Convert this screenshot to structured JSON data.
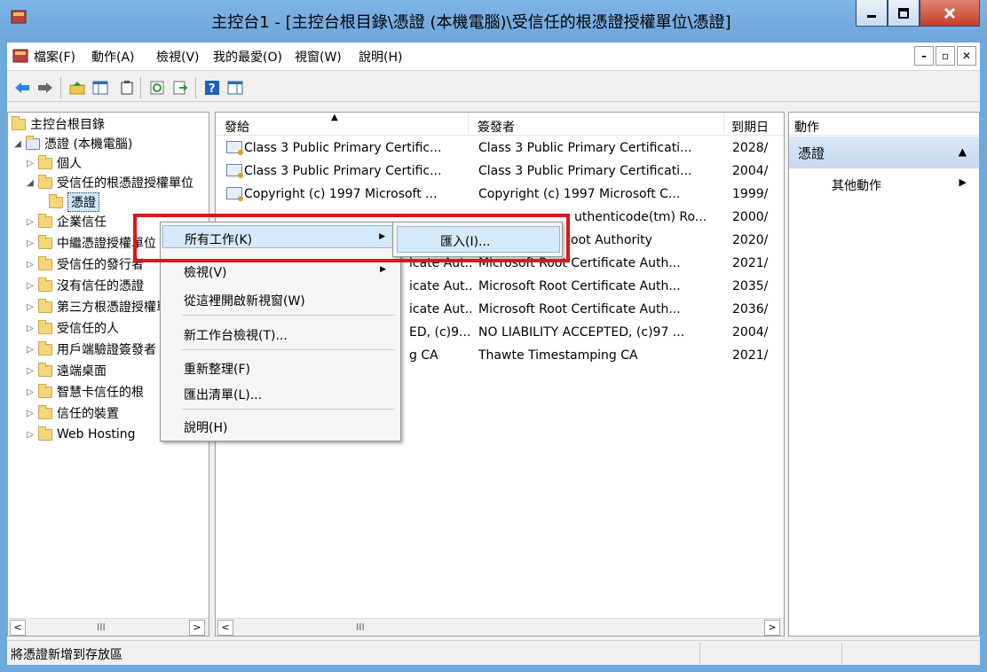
{
  "window": {
    "title": "主控台1 - [主控台根目錄\\憑證 (本機電腦)\\受信任的根憑證授權單位\\憑證]"
  },
  "menubar": {
    "items": [
      "檔案(F)",
      "動作(A)",
      "檢視(V)",
      "我的最愛(O)",
      "視窗(W)",
      "說明(H)"
    ]
  },
  "toolbar": {
    "icons": [
      "back-icon",
      "forward-icon",
      "up-folder-icon",
      "show-hide-tree-icon",
      "properties-icon",
      "refresh-icon",
      "export-list-icon",
      "help-icon",
      "show-hide-action-pane-icon"
    ]
  },
  "tree": {
    "root": "主控台根目錄",
    "items": [
      {
        "label": "憑證 (本機電腦)",
        "expanded": true
      },
      {
        "label": "個人",
        "expanded": false
      },
      {
        "label": "受信任的根憑證授權單位",
        "expanded": true
      },
      {
        "label": "憑證"
      },
      {
        "label": "企業信任",
        "expanded": false
      },
      {
        "label": "中繼憑證授權單位",
        "expanded": false
      },
      {
        "label": "受信任的發行者",
        "expanded": false
      },
      {
        "label": "沒有信任的憑證",
        "expanded": false
      },
      {
        "label": "第三方根憑證授權單位",
        "expanded": false
      },
      {
        "label": "受信任的人",
        "expanded": false
      },
      {
        "label": "用戶端驗證簽發者",
        "expanded": false
      },
      {
        "label": "遠端桌面",
        "expanded": false
      },
      {
        "label": "智慧卡信任的根",
        "expanded": false
      },
      {
        "label": "信任的裝置",
        "expanded": false
      },
      {
        "label": "Web Hosting",
        "expanded": false
      }
    ]
  },
  "list": {
    "columns": [
      "發給",
      "簽發者",
      "到期日"
    ],
    "rows": [
      {
        "issued_to": "Class 3 Public Primary Certific...",
        "issued_by": "Class 3 Public Primary Certificati...",
        "expires": "2028/"
      },
      {
        "issued_to": "Class 3 Public Primary Certific...",
        "issued_by": "Class 3 Public Primary Certificati...",
        "expires": "2004/"
      },
      {
        "issued_to": "Copyright (c) 1997 Microsoft ...",
        "issued_by": "Copyright (c) 1997 Microsoft C...",
        "expires": "1999/"
      },
      {
        "issued_to": "",
        "issued_by": "uthenticode(tm) Ro...",
        "expires": "2000/"
      },
      {
        "issued_to": "",
        "issued_by": "oot Authority",
        "expires": "2020/"
      },
      {
        "issued_to": "icate Aut...",
        "issued_by": "Microsoft Root Certificate Auth...",
        "expires": "2021/"
      },
      {
        "issued_to": "icate Aut...",
        "issued_by": "Microsoft Root Certificate Auth...",
        "expires": "2035/"
      },
      {
        "issued_to": "icate Aut...",
        "issued_by": "Microsoft Root Certificate Auth...",
        "expires": "2036/"
      },
      {
        "issued_to": "ED, (c)9...",
        "issued_by": "NO LIABILITY ACCEPTED, (c)97 ...",
        "expires": "2004/"
      },
      {
        "issued_to": "g CA",
        "issued_by": "Thawte Timestamping CA",
        "expires": "2021/"
      }
    ]
  },
  "actions": {
    "header": "動作",
    "section": "憑證",
    "item": "其他動作"
  },
  "context_menu": {
    "items": [
      "所有工作(K)",
      "檢視(V)",
      "從這裡開啟新視窗(W)",
      "新工作台檢視(T)...",
      "重新整理(F)",
      "匯出清單(L)...",
      "說明(H)"
    ],
    "submenu_item": "匯入(I)..."
  },
  "status": {
    "text": "將憑證新增到存放區"
  },
  "scrollbar": {
    "thumb": "III"
  },
  "colors": {
    "title_bar": "#6fa8dc",
    "highlight": "#e0141e",
    "selection": "#cce8ff"
  }
}
